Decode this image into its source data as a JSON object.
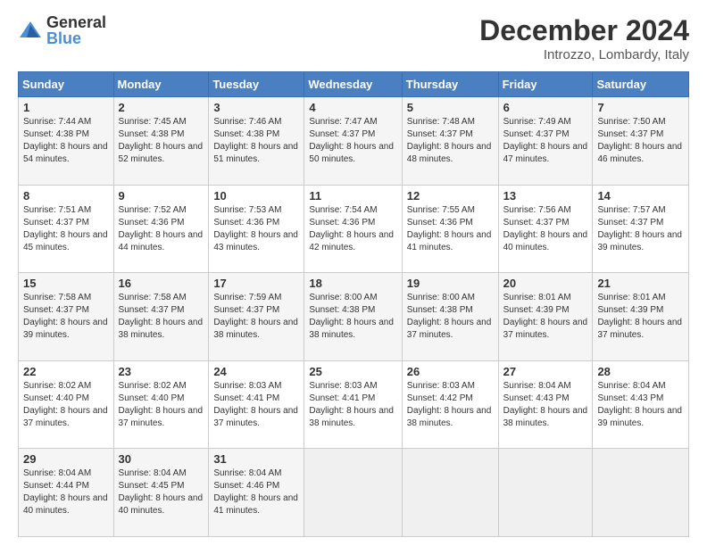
{
  "logo": {
    "general": "General",
    "blue": "Blue"
  },
  "header": {
    "title": "December 2024",
    "subtitle": "Introzzo, Lombardy, Italy"
  },
  "weekdays": [
    "Sunday",
    "Monday",
    "Tuesday",
    "Wednesday",
    "Thursday",
    "Friday",
    "Saturday"
  ],
  "weeks": [
    [
      {
        "day": "1",
        "sunrise": "7:44 AM",
        "sunset": "4:38 PM",
        "daylight": "8 hours and 54 minutes."
      },
      {
        "day": "2",
        "sunrise": "7:45 AM",
        "sunset": "4:38 PM",
        "daylight": "8 hours and 52 minutes."
      },
      {
        "day": "3",
        "sunrise": "7:46 AM",
        "sunset": "4:38 PM",
        "daylight": "8 hours and 51 minutes."
      },
      {
        "day": "4",
        "sunrise": "7:47 AM",
        "sunset": "4:37 PM",
        "daylight": "8 hours and 50 minutes."
      },
      {
        "day": "5",
        "sunrise": "7:48 AM",
        "sunset": "4:37 PM",
        "daylight": "8 hours and 48 minutes."
      },
      {
        "day": "6",
        "sunrise": "7:49 AM",
        "sunset": "4:37 PM",
        "daylight": "8 hours and 47 minutes."
      },
      {
        "day": "7",
        "sunrise": "7:50 AM",
        "sunset": "4:37 PM",
        "daylight": "8 hours and 46 minutes."
      }
    ],
    [
      {
        "day": "8",
        "sunrise": "7:51 AM",
        "sunset": "4:37 PM",
        "daylight": "8 hours and 45 minutes."
      },
      {
        "day": "9",
        "sunrise": "7:52 AM",
        "sunset": "4:36 PM",
        "daylight": "8 hours and 44 minutes."
      },
      {
        "day": "10",
        "sunrise": "7:53 AM",
        "sunset": "4:36 PM",
        "daylight": "8 hours and 43 minutes."
      },
      {
        "day": "11",
        "sunrise": "7:54 AM",
        "sunset": "4:36 PM",
        "daylight": "8 hours and 42 minutes."
      },
      {
        "day": "12",
        "sunrise": "7:55 AM",
        "sunset": "4:36 PM",
        "daylight": "8 hours and 41 minutes."
      },
      {
        "day": "13",
        "sunrise": "7:56 AM",
        "sunset": "4:37 PM",
        "daylight": "8 hours and 40 minutes."
      },
      {
        "day": "14",
        "sunrise": "7:57 AM",
        "sunset": "4:37 PM",
        "daylight": "8 hours and 39 minutes."
      }
    ],
    [
      {
        "day": "15",
        "sunrise": "7:58 AM",
        "sunset": "4:37 PM",
        "daylight": "8 hours and 39 minutes."
      },
      {
        "day": "16",
        "sunrise": "7:58 AM",
        "sunset": "4:37 PM",
        "daylight": "8 hours and 38 minutes."
      },
      {
        "day": "17",
        "sunrise": "7:59 AM",
        "sunset": "4:37 PM",
        "daylight": "8 hours and 38 minutes."
      },
      {
        "day": "18",
        "sunrise": "8:00 AM",
        "sunset": "4:38 PM",
        "daylight": "8 hours and 38 minutes."
      },
      {
        "day": "19",
        "sunrise": "8:00 AM",
        "sunset": "4:38 PM",
        "daylight": "8 hours and 37 minutes."
      },
      {
        "day": "20",
        "sunrise": "8:01 AM",
        "sunset": "4:39 PM",
        "daylight": "8 hours and 37 minutes."
      },
      {
        "day": "21",
        "sunrise": "8:01 AM",
        "sunset": "4:39 PM",
        "daylight": "8 hours and 37 minutes."
      }
    ],
    [
      {
        "day": "22",
        "sunrise": "8:02 AM",
        "sunset": "4:40 PM",
        "daylight": "8 hours and 37 minutes."
      },
      {
        "day": "23",
        "sunrise": "8:02 AM",
        "sunset": "4:40 PM",
        "daylight": "8 hours and 37 minutes."
      },
      {
        "day": "24",
        "sunrise": "8:03 AM",
        "sunset": "4:41 PM",
        "daylight": "8 hours and 37 minutes."
      },
      {
        "day": "25",
        "sunrise": "8:03 AM",
        "sunset": "4:41 PM",
        "daylight": "8 hours and 38 minutes."
      },
      {
        "day": "26",
        "sunrise": "8:03 AM",
        "sunset": "4:42 PM",
        "daylight": "8 hours and 38 minutes."
      },
      {
        "day": "27",
        "sunrise": "8:04 AM",
        "sunset": "4:43 PM",
        "daylight": "8 hours and 38 minutes."
      },
      {
        "day": "28",
        "sunrise": "8:04 AM",
        "sunset": "4:43 PM",
        "daylight": "8 hours and 39 minutes."
      }
    ],
    [
      {
        "day": "29",
        "sunrise": "8:04 AM",
        "sunset": "4:44 PM",
        "daylight": "8 hours and 40 minutes."
      },
      {
        "day": "30",
        "sunrise": "8:04 AM",
        "sunset": "4:45 PM",
        "daylight": "8 hours and 40 minutes."
      },
      {
        "day": "31",
        "sunrise": "8:04 AM",
        "sunset": "4:46 PM",
        "daylight": "8 hours and 41 minutes."
      },
      null,
      null,
      null,
      null
    ]
  ]
}
